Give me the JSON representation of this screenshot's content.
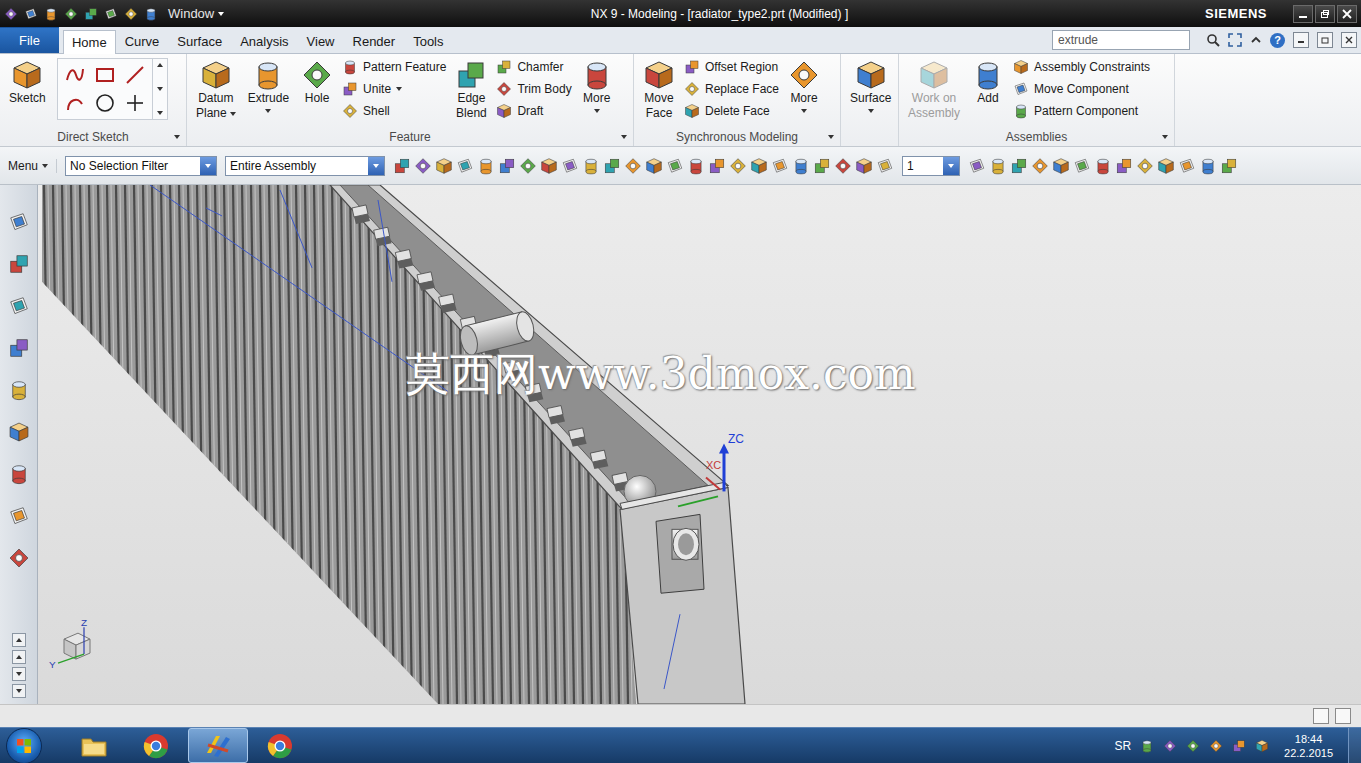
{
  "window": {
    "title": "NX 9 - Modeling - [radiator_type2.prt (Modified) ]",
    "brand": "SIEMENS",
    "window_menu": "Window"
  },
  "ribbon_tabs": [
    {
      "label": "File",
      "kind": "file",
      "selected": false
    },
    {
      "label": "Home",
      "kind": "tab",
      "selected": true
    },
    {
      "label": "Curve",
      "kind": "tab",
      "selected": false
    },
    {
      "label": "Surface",
      "kind": "tab",
      "selected": false
    },
    {
      "label": "Analysis",
      "kind": "tab",
      "selected": false
    },
    {
      "label": "View",
      "kind": "tab",
      "selected": false
    },
    {
      "label": "Render",
      "kind": "tab",
      "selected": false
    },
    {
      "label": "Tools",
      "kind": "tab",
      "selected": false
    }
  ],
  "search": {
    "value": "extrude",
    "help": "?"
  },
  "ribbon_groups": [
    {
      "label": "Direct Sketch",
      "expander": true,
      "columns": [
        {
          "kind": "large",
          "lines": [
            "Sketch"
          ],
          "menu": false,
          "disabled": false
        },
        {
          "kind": "tools"
        }
      ]
    },
    {
      "label": "Feature",
      "expander": true,
      "columns": [
        {
          "kind": "large",
          "lines": [
            "Datum",
            "Plane"
          ],
          "menu": true,
          "disabled": false
        },
        {
          "kind": "large",
          "lines": [
            "Extrude"
          ],
          "menu": true,
          "disabled": false
        },
        {
          "kind": "large",
          "lines": [
            "Hole"
          ],
          "menu": false,
          "disabled": false
        },
        {
          "kind": "stack",
          "items": [
            {
              "label": "Pattern Feature",
              "menu": false
            },
            {
              "label": "Unite",
              "menu": true
            },
            {
              "label": "Shell",
              "menu": false
            }
          ]
        },
        {
          "kind": "large",
          "lines": [
            "Edge",
            "Blend"
          ],
          "menu": false,
          "disabled": false
        },
        {
          "kind": "stack",
          "items": [
            {
              "label": "Chamfer",
              "menu": false
            },
            {
              "label": "Trim Body",
              "menu": false
            },
            {
              "label": "Draft",
              "menu": false
            }
          ]
        },
        {
          "kind": "large",
          "lines": [
            "More"
          ],
          "menu": true,
          "disabled": false
        }
      ]
    },
    {
      "label": "Synchronous Modeling",
      "expander": true,
      "columns": [
        {
          "kind": "large",
          "lines": [
            "Move",
            "Face"
          ],
          "menu": false,
          "disabled": false
        },
        {
          "kind": "stack",
          "items": [
            {
              "label": "Offset Region",
              "menu": false
            },
            {
              "label": "Replace Face",
              "menu": false
            },
            {
              "label": "Delete Face",
              "menu": false
            }
          ]
        },
        {
          "kind": "large",
          "lines": [
            "More"
          ],
          "menu": true,
          "disabled": false
        }
      ]
    },
    {
      "label": "",
      "expander": false,
      "columns": [
        {
          "kind": "large",
          "lines": [
            "Surface"
          ],
          "menu": true,
          "disabled": false
        }
      ]
    },
    {
      "label": "Assemblies",
      "expander": true,
      "columns": [
        {
          "kind": "large",
          "lines": [
            "Work on",
            "Assembly"
          ],
          "menu": false,
          "disabled": true
        },
        {
          "kind": "large",
          "lines": [
            "Add"
          ],
          "menu": false,
          "disabled": false
        },
        {
          "kind": "stack",
          "items": [
            {
              "label": "Assembly Constraints",
              "menu": false
            },
            {
              "label": "Move Component",
              "menu": false
            },
            {
              "label": "Pattern Component",
              "menu": false
            }
          ]
        }
      ]
    }
  ],
  "toolbar": {
    "menu": "Menu",
    "filters": [
      {
        "value": "No Selection Filter"
      },
      {
        "value": "Entire Assembly"
      }
    ],
    "layer": "1"
  },
  "viewport": {
    "watermark": "莫西网www.3dmox.com",
    "wcs_labels": [
      "ZC",
      "XC"
    ],
    "triad_labels": [
      "Z",
      "Y"
    ]
  },
  "taskbar": {
    "language": "SR",
    "time": "18:44",
    "date": "22.2.2015",
    "apps": [
      {
        "kind": "explorer",
        "active": false
      },
      {
        "kind": "chrome",
        "active": false
      },
      {
        "kind": "nx",
        "active": true
      },
      {
        "kind": "chrome",
        "active": false
      }
    ]
  }
}
